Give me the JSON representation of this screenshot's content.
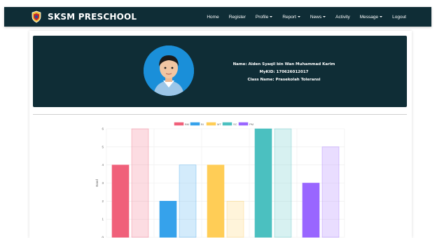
{
  "brand": {
    "title": "SKSM PRESCHOOL",
    "logo_icon": "school-crest-icon"
  },
  "nav": {
    "items": [
      {
        "label": "Home",
        "dropdown": false
      },
      {
        "label": "Register",
        "dropdown": false
      },
      {
        "label": "Profile",
        "dropdown": true
      },
      {
        "label": "Report",
        "dropdown": true
      },
      {
        "label": "News",
        "dropdown": true
      },
      {
        "label": "Activity",
        "dropdown": false
      },
      {
        "label": "Message",
        "dropdown": true
      },
      {
        "label": "Logout",
        "dropdown": false
      }
    ]
  },
  "profile": {
    "name_line": "Name: Aiden Syaqil bin Wan Muhammad Karim",
    "mykid_line": "MyKID: 170626012017",
    "class_line": "Class Name: Prasekolah Toleransi",
    "avatar_icon": "student-photo"
  },
  "colors": {
    "navbar_bg": "#0f2d36",
    "panel_bg": "#0f2d36",
    "BM": "#f0607a",
    "BI": "#36a2eb",
    "MT": "#ffcd56",
    "SC": "#4bc0c0",
    "PM": "#9966ff"
  },
  "chart_data": {
    "type": "bar",
    "title": "",
    "xlabel": "",
    "ylabel": "Band",
    "ylim": [
      0,
      6
    ],
    "y_ticks": [
      "0",
      "1",
      "2",
      "3",
      "4",
      "5",
      "6"
    ],
    "legend_position": "top",
    "grid": true,
    "categories": [
      "BM",
      "BI",
      "MT",
      "SC",
      "PM"
    ],
    "series": [
      {
        "name": "BM",
        "values": [
          4,
          6
        ],
        "color": "#f0607a"
      },
      {
        "name": "BI",
        "values": [
          2,
          4
        ],
        "color": "#36a2eb"
      },
      {
        "name": "MT",
        "values": [
          4,
          2
        ],
        "color": "#ffcd56"
      },
      {
        "name": "SC",
        "values": [
          6,
          6
        ],
        "color": "#4bc0c0"
      },
      {
        "name": "PM",
        "values": [
          3,
          5
        ],
        "color": "#9966ff"
      }
    ]
  }
}
